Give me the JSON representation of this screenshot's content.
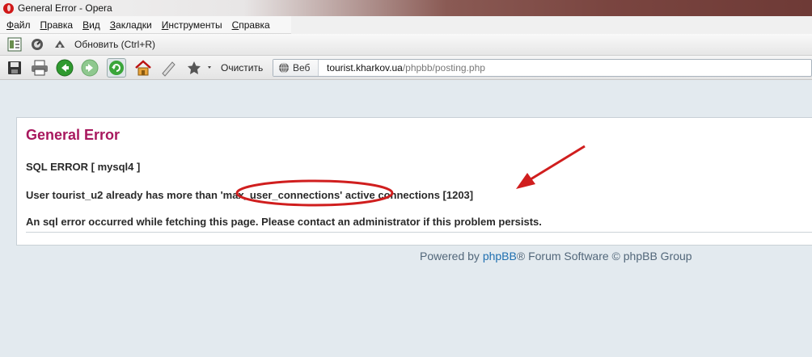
{
  "window": {
    "title": "General Error - Opera"
  },
  "menu": {
    "items": [
      {
        "first": "Ф",
        "rest": "айл"
      },
      {
        "first": "П",
        "rest": "равка"
      },
      {
        "first": "В",
        "rest": "ид"
      },
      {
        "first": "З",
        "rest": "акладки"
      },
      {
        "first": "И",
        "rest": "нструменты"
      },
      {
        "first": "С",
        "rest": "правка"
      }
    ]
  },
  "panel": {
    "reload_label": "Обновить (Ctrl+R)"
  },
  "toolbar": {
    "clear_label": "Очистить"
  },
  "address": {
    "badge": "Веб",
    "host": "tourist.kharkov.ua",
    "path": "/phpbb/posting.php"
  },
  "error": {
    "title": "General Error",
    "sql_error": "SQL ERROR [ mysql4 ]",
    "message": "User tourist_u2 already has more than 'max_user_connections' active connections [1203]",
    "hint": "An sql error occurred while fetching this page. Please contact an administrator if this problem persists."
  },
  "footer": {
    "prefix": "Powered by ",
    "link": "phpBB",
    "suffix": "® Forum Software © phpBB Group"
  },
  "colors": {
    "title": "#a8185e",
    "link": "#1f6fb0",
    "annotation": "#d01e1e",
    "page_bg": "#e3eaef"
  }
}
